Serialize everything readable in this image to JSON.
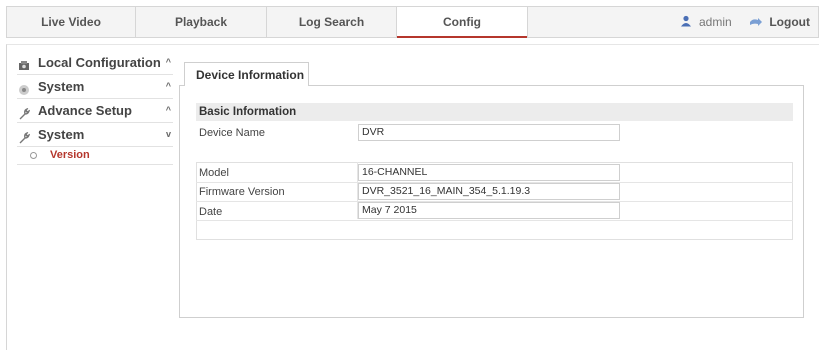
{
  "nav": {
    "tabs": [
      {
        "label": "Live Video"
      },
      {
        "label": "Playback"
      },
      {
        "label": "Log Search"
      },
      {
        "label": "Config"
      }
    ],
    "active_tab": "Config",
    "user": "admin",
    "logout_label": "Logout",
    "accent_color": "#b5362c"
  },
  "sidebar": {
    "items": [
      {
        "label": "Local Configuration",
        "icon": "local-config-icon",
        "arrow": "^"
      },
      {
        "label": "System",
        "icon": "system-icon",
        "arrow": "^"
      },
      {
        "label": "Advance Setup",
        "icon": "wrench-icon",
        "arrow": "^"
      },
      {
        "label": "System",
        "icon": "wrench-icon",
        "arrow": "v"
      }
    ],
    "subitems": [
      {
        "label": "Version"
      }
    ]
  },
  "content": {
    "tab_label": "Device Information",
    "section_title": "Basic Information",
    "fields": [
      {
        "label": "Device Name",
        "value": "DVR"
      },
      {
        "label": "Model",
        "value": "16-CHANNEL"
      },
      {
        "label": "Firmware Version",
        "value": "DVR_3521_16_MAIN_354_5.1.19.3"
      },
      {
        "label": "Date",
        "value": "May  7 2015"
      }
    ]
  }
}
